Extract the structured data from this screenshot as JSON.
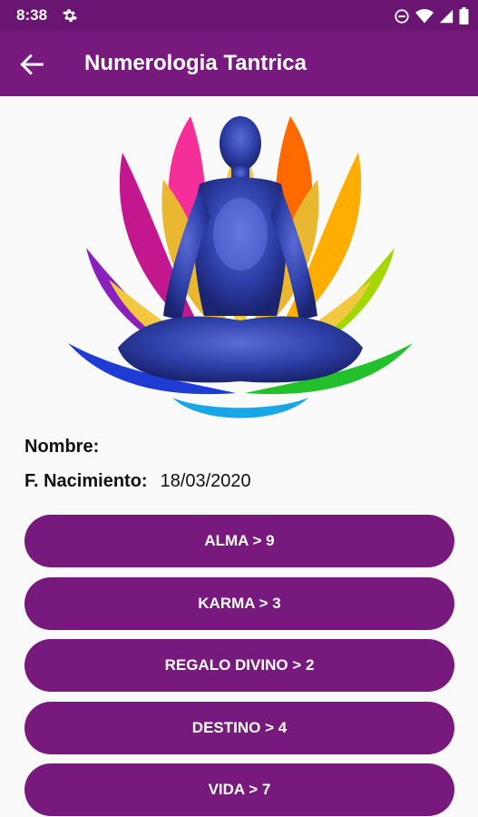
{
  "status": {
    "time": "8:38"
  },
  "appbar": {
    "title": "Numerologia Tantrica"
  },
  "info": {
    "name_label": "Nombre:",
    "name_value": "",
    "birth_label": "F. Nacimiento:",
    "birth_value": "18/03/2020"
  },
  "buttons": [
    {
      "label": "ALMA > 9"
    },
    {
      "label": "KARMA > 3"
    },
    {
      "label": "REGALO DIVINO > 2"
    },
    {
      "label": "DESTINO > 4"
    },
    {
      "label": "VIDA > 7"
    }
  ],
  "colors": {
    "primary": "#78197e",
    "status_bar": "#6a1572",
    "background": "#fafafa"
  }
}
